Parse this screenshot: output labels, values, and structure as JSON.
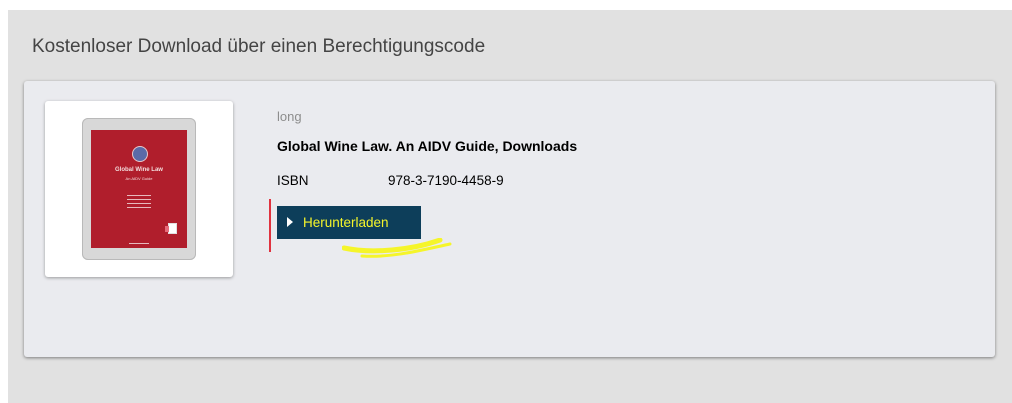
{
  "section": {
    "title": "Kostenloser Download über einen Berechtigungscode"
  },
  "product": {
    "type_label": "long",
    "title": "Global Wine Law. An AIDV Guide, Downloads",
    "isbn_label": "ISBN",
    "isbn_value": "978-3-7190-4458-9",
    "cover": {
      "title": "Global Wine Law",
      "subtitle": "An AIDV Guide",
      "color": "#b01e2c"
    }
  },
  "actions": {
    "download_label": "Herunterladen",
    "download_bg": "#0d3e5a",
    "download_text_color": "#f5f52a",
    "download_icon": "play-triangle-icon"
  },
  "annotations": {
    "marker_color": "#e0333f",
    "highlight_color": "#f5f52a"
  }
}
